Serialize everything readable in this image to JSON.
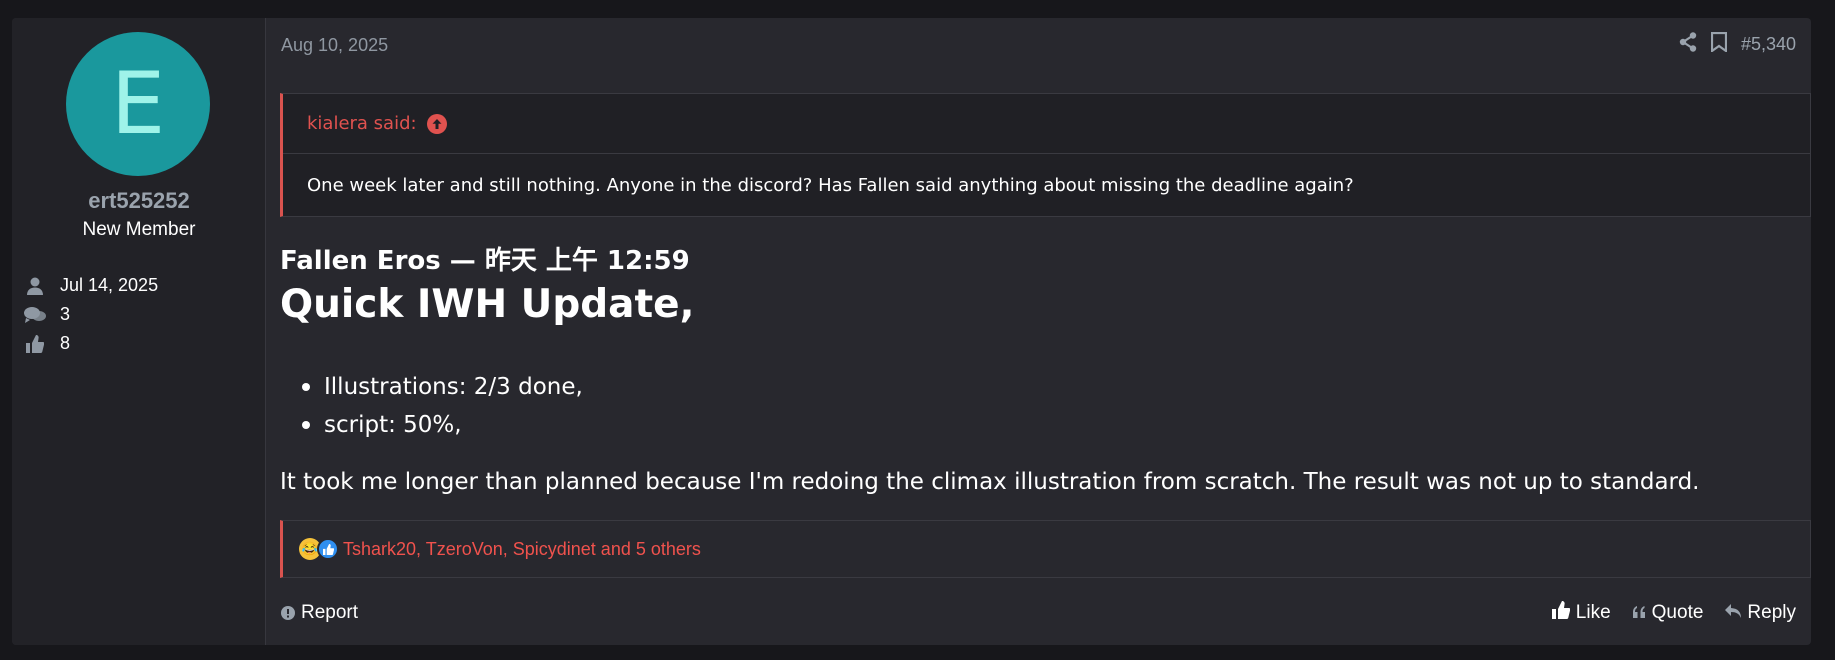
{
  "user": {
    "avatar_letter": "E",
    "username": "ert525252",
    "title": "New Member",
    "joined": "Jul 14, 2025",
    "messages": "3",
    "reactions": "8"
  },
  "post": {
    "date": "Aug 10, 2025",
    "number": "#5,340",
    "quote": {
      "author": "kialera said:",
      "text": "One week later and still nothing. Anyone in the discord? Has Fallen said anything about missing the deadline again?"
    },
    "author_line": "Fallen Eros — 昨天 上午 12:59",
    "headline": "Quick IWH Update,",
    "bullets": [
      "Illustrations: 2/3 done,",
      "script: 50%,"
    ],
    "body": "It took me longer than planned because I'm redoing the climax illustration from scratch. The result was not up to standard.",
    "reactions_text": "Tshark20, TzeroVon, Spicydinet and 5 others"
  },
  "actions": {
    "report": "Report",
    "like": "Like",
    "quote": "Quote",
    "reply": "Reply"
  },
  "colors": {
    "accent": "#d9534f",
    "avatar_bg": "#1a989d",
    "background": "#28282e"
  }
}
